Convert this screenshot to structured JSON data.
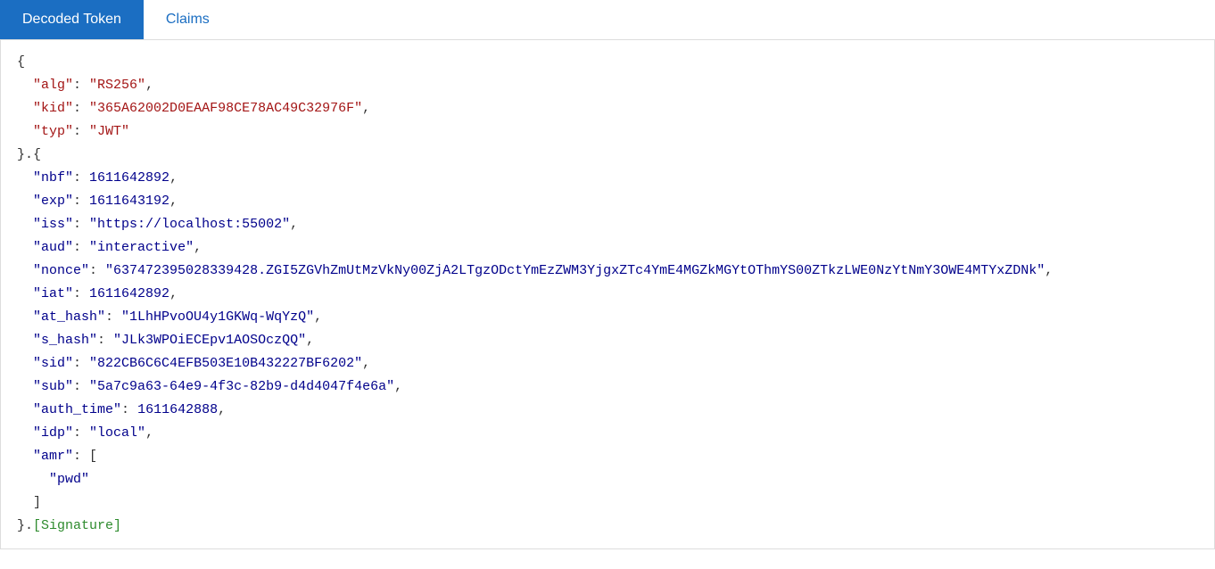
{
  "tabs": [
    "Decoded Token",
    "Claims"
  ],
  "activeTab": 0,
  "header": [
    {
      "key": "alg",
      "value": "RS256",
      "quoted": true
    },
    {
      "key": "kid",
      "value": "365A62002D0EAAF98CE78AC49C32976F",
      "quoted": true
    },
    {
      "key": "typ",
      "value": "JWT",
      "quoted": true
    }
  ],
  "payload": [
    {
      "key": "nbf",
      "value": 1611642892,
      "quoted": false
    },
    {
      "key": "exp",
      "value": 1611643192,
      "quoted": false
    },
    {
      "key": "iss",
      "value": "https://localhost:55002",
      "quoted": true
    },
    {
      "key": "aud",
      "value": "interactive",
      "quoted": true
    },
    {
      "key": "nonce",
      "value": "637472395028339428.ZGI5ZGVhZmUtMzVkNy00ZjA2LTgzODctYmEzZWM3YjgxZTc4YmE4MGZkMGYtOThmYS00ZTkzLWE0NzYtNmY3OWE4MTYxZDNk",
      "quoted": true
    },
    {
      "key": "iat",
      "value": 1611642892,
      "quoted": false
    },
    {
      "key": "at_hash",
      "value": "1LhHPvoOU4y1GKWq-WqYzQ",
      "quoted": true
    },
    {
      "key": "s_hash",
      "value": "JLk3WPOiECEpv1AOSOczQQ",
      "quoted": true
    },
    {
      "key": "sid",
      "value": "822CB6C6C4EFB503E10B432227BF6202",
      "quoted": true
    },
    {
      "key": "sub",
      "value": "5a7c9a63-64e9-4f3c-82b9-d4d4047f4e6a",
      "quoted": true
    },
    {
      "key": "auth_time",
      "value": 1611642888,
      "quoted": false
    },
    {
      "key": "idp",
      "value": "local",
      "quoted": true
    },
    {
      "key": "amr",
      "value": [
        "pwd"
      ],
      "array": true
    }
  ],
  "signatureLabel": "[Signature]"
}
